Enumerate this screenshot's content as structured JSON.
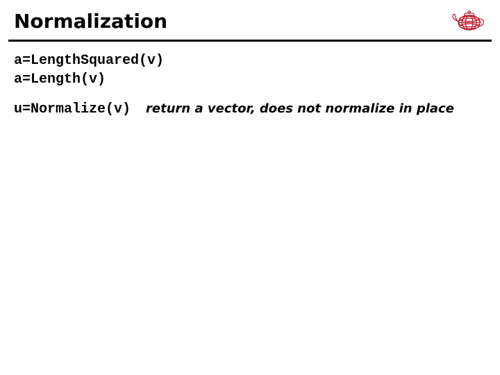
{
  "header": {
    "title": "Normalization",
    "logo_name": "teapot-wire-logo"
  },
  "content": {
    "code1": "a=LengthSquared(v)",
    "code2": "a=Length(v)",
    "code3": "u=Normalize(v)",
    "note": "return a vector, does not normalize in place"
  },
  "colors": {
    "logo": "#bd1b2a"
  }
}
